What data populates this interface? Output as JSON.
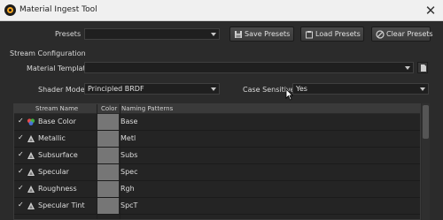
{
  "window": {
    "title": "Material Ingest Tool",
    "close_glyph": "✕"
  },
  "presets": {
    "label": "Presets",
    "value": "",
    "save_label": "Save Presets",
    "load_label": "Load Presets",
    "clear_label": "Clear Presets"
  },
  "stream_config": {
    "heading": "Stream Configuration",
    "material_template_label": "Material Template",
    "material_template_value": "",
    "shader_model_label": "Shader Model",
    "shader_model_value": "Principled BRDF",
    "case_sensitive_label": "Case Sensitive",
    "case_sensitive_value": "Yes"
  },
  "table": {
    "columns": [
      "Stream Name",
      "Color",
      "Naming Patterns"
    ],
    "check_glyph": "✓",
    "rows": [
      {
        "name": "Base Color",
        "pattern": "Base",
        "icon": "rgb-icon"
      },
      {
        "name": "Metallic",
        "pattern": "Metl",
        "icon": "grayscale-icon"
      },
      {
        "name": "Subsurface",
        "pattern": "Subs",
        "icon": "grayscale-icon"
      },
      {
        "name": "Specular",
        "pattern": "Spec",
        "icon": "grayscale-icon"
      },
      {
        "name": "Roughness",
        "pattern": "Rgh",
        "icon": "grayscale-icon"
      },
      {
        "name": "Specular Tint",
        "pattern": "SpcT",
        "icon": "grayscale-icon"
      }
    ]
  },
  "colors": {
    "accent": "#f5a623",
    "panel_bg": "#2b2b2b",
    "swatch": "#767676"
  }
}
